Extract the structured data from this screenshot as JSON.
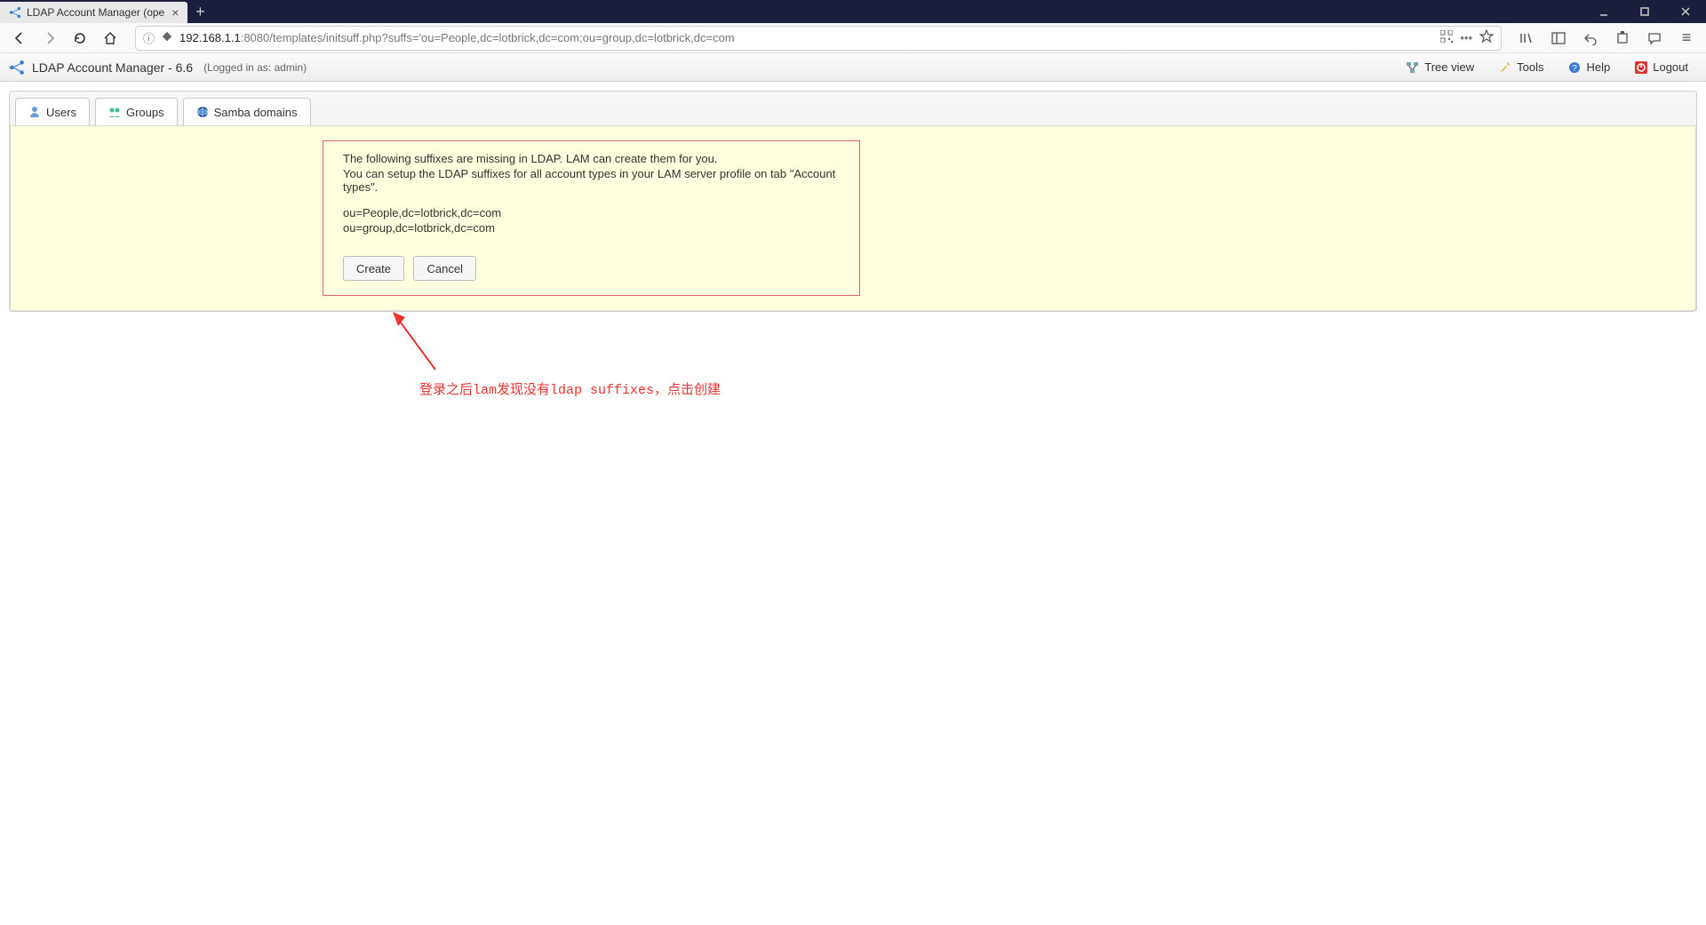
{
  "browser": {
    "tab_title": "LDAP Account Manager (ope",
    "url_host": "192.168.1.1",
    "url_rest": ":8080/templates/initsuff.php?suffs='ou=People,dc=lotbrick,dc=com;ou=group,dc=lotbrick,dc=com"
  },
  "app": {
    "title": "LDAP Account Manager - 6.6",
    "logged_in": "(Logged in as: admin)",
    "links": {
      "tree_view": "Tree view",
      "tools": "Tools",
      "help": "Help",
      "logout": "Logout"
    }
  },
  "tabs": {
    "users": "Users",
    "groups": "Groups",
    "samba": "Samba domains"
  },
  "message": {
    "line1": "The following suffixes are missing in LDAP. LAM can create them for you.",
    "line2": "You can setup the LDAP suffixes for all account types in your LAM server profile on tab \"Account types\".",
    "suffix1": "ou=People,dc=lotbrick,dc=com",
    "suffix2": "ou=group,dc=lotbrick,dc=com",
    "create": "Create",
    "cancel": "Cancel"
  },
  "annotation": "登录之后lam发现没有ldap suffixes，点击创建"
}
